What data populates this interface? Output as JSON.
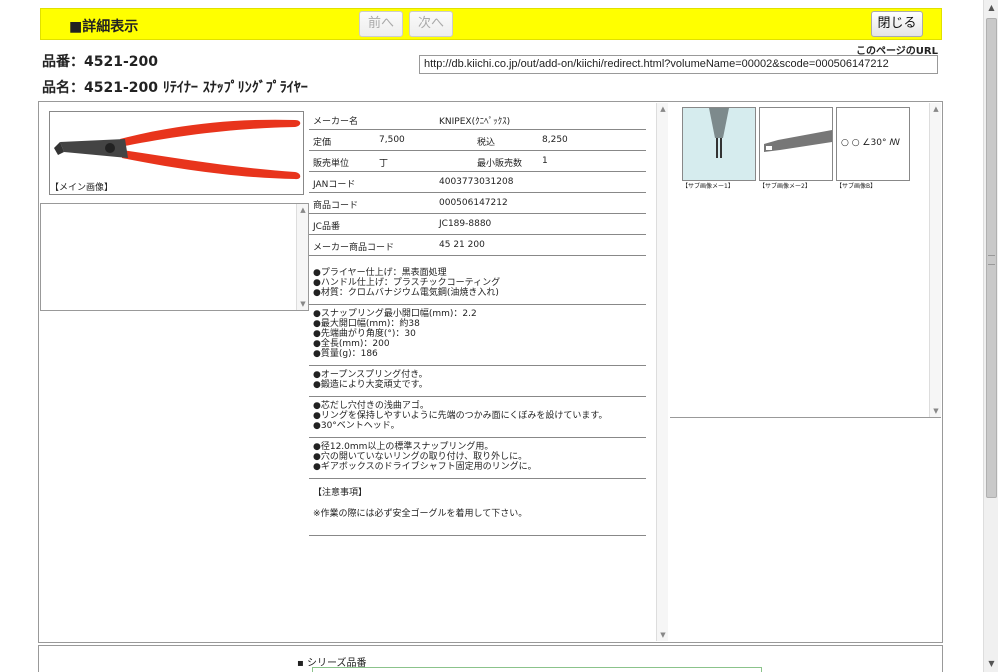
{
  "header": {
    "title": "■詳細表示",
    "prev_label": "前へ",
    "next_label": "次へ",
    "close_label": "閉じる"
  },
  "page_url": {
    "label": "このページのURL",
    "value": "http://db.kiichi.co.jp/out/add-on/kiichi/redirect.html?volumeName=00002&scode=000506147212"
  },
  "product": {
    "hinban": "品番：4521-200",
    "hinmei": "品名：4521-200 ﾘﾃｲﾅｰ ｽﾅｯﾌﾟﾘﾝｸﾞﾌﾟﾗｲﾔｰ"
  },
  "main_image": {
    "caption": "【メイン画像】"
  },
  "spec": {
    "maker_label": "メーカー名",
    "maker_value": "KNIPEX(ｸﾆﾍﾟｯｸｽ)",
    "price_label": "定価",
    "price_value": "7,500",
    "tax_label": "税込",
    "tax_value": "8,250",
    "unit_label": "販売単位",
    "unit_value": "丁",
    "min_label": "最小販売数",
    "min_value": "1",
    "jan_label": "JANコード",
    "jan_value": "4003773031208",
    "code_label": "商品コード",
    "code_value": "000506147212",
    "jc_label": "JC品番",
    "jc_value": "JC189-8880",
    "maker_code_label": "メーカー商品コード",
    "maker_code_value": "45 21 200"
  },
  "descriptions": {
    "block1": [
      "●プライヤー仕上げ：黒表面処理",
      "●ハンドル仕上げ：プラスチックコーティング",
      "●材質：クロムバナジウム電気鋼(油焼き入れ)"
    ],
    "block2": [
      "●スナップリング最小開口幅(mm)：2.2",
      "●最大開口幅(mm)：約38",
      "●先端曲がり角度(°)：30",
      "●全長(mm)：200",
      "●質量(g)：186"
    ],
    "block3": [
      "●オープンスプリング付き。",
      "●鍛造により大変頑丈です。"
    ],
    "block4": [
      "●芯だし穴付きの浅曲アゴ。",
      "●リングを保持しやすいように先端のつかみ面にくぼみを設けています。",
      "●30°ベントヘッド。"
    ],
    "block5": [
      "●径12.0mm以上の標準スナップリング用。",
      "●穴の開いていないリングの取り付け、取り外しに。",
      "●ギアボックスのドライブシャフト固定用のリングに。"
    ],
    "notes": [
      "【注意事項】",
      "※作業の際には必ず安全ゴーグルを着用して下さい。"
    ]
  },
  "sub_images": {
    "caption1": "【サブ画像メー1】",
    "caption2": "【サブ画像メー2】",
    "caption3": "【サブ画像B】",
    "diagram_text": "○ ○ ∠30° ꟿ"
  },
  "series": {
    "label": "シリーズ品番"
  },
  "colors": {
    "header_bg": "#ffff00",
    "plier_handle": "#e8341c"
  },
  "icons": [
    "scroll-up-icon",
    "scroll-down-icon"
  ]
}
